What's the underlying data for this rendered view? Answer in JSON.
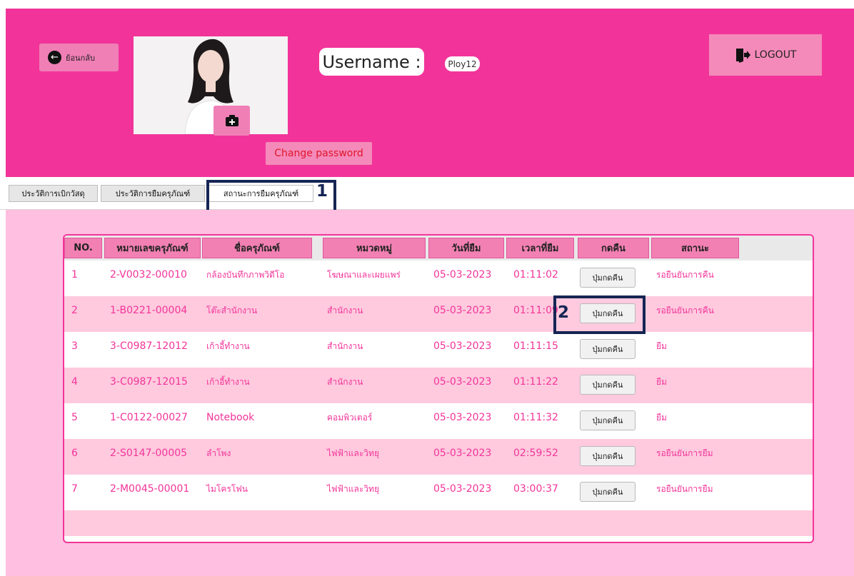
{
  "header": {
    "back_label": "ย้อนกลับ",
    "username_label": "Username :",
    "username_value": "Ploy12",
    "logout_label": "LOGOUT",
    "change_password_label": "Change password",
    "colors": {
      "header_bg": "#f2349a",
      "button_bg": "#f48ab9",
      "change_password_text": "#e0162c"
    }
  },
  "tabs": [
    {
      "label": "ประวัติการเบิกวัสดุ"
    },
    {
      "label": "ประวัติการยืมครุภัณฑ์"
    },
    {
      "label": "สถานะการยืมครุภัณฑ์",
      "selected": true
    }
  ],
  "annotations": [
    {
      "label": "1"
    },
    {
      "label": "2"
    }
  ],
  "table": {
    "columns": [
      "NO.",
      "หมายเลขครุภัณฑ์",
      "ชื่อครุภัณฑ์",
      "หมวดหมู่",
      "วันที่ยืม",
      "เวลาที่ยืม",
      "กดคืน",
      "สถานะ"
    ],
    "return_button_label": "ปุ่มกดคืน",
    "rows": [
      {
        "no": "1",
        "asset_id": "2-V0032-00010",
        "name": "กล้องบันทึกภาพวิดีโอ",
        "category": "โฆษณาและเผยแพร่",
        "date": "05-03-2023",
        "time": "01:11:02",
        "status": "รอยืนยันการคืน"
      },
      {
        "no": "2",
        "asset_id": "1-B0221-00004",
        "name": "โต๊ะสำนักงาน",
        "category": "สำนักงาน",
        "date": "05-03-2023",
        "time": "01:11:09",
        "status": "รอยืนยันการคืน"
      },
      {
        "no": "3",
        "asset_id": "3-C0987-12012",
        "name": "เก้าอี้ทำงาน",
        "category": "สำนักงาน",
        "date": "05-03-2023",
        "time": "01:11:15",
        "status": "ยืม"
      },
      {
        "no": "4",
        "asset_id": "3-C0987-12015",
        "name": "เก้าอี้ทำงาน",
        "category": "สำนักงาน",
        "date": "05-03-2023",
        "time": "01:11:22",
        "status": "ยืม"
      },
      {
        "no": "5",
        "asset_id": "1-C0122-00027",
        "name": "Notebook",
        "category": "คอมพิวเตอร์",
        "date": "05-03-2023",
        "time": "01:11:32",
        "status": "ยืม"
      },
      {
        "no": "6",
        "asset_id": "2-S0147-00005",
        "name": "ลำโพง",
        "category": "ไฟฟ้าและวิทยุ",
        "date": "05-03-2023",
        "time": "02:59:52",
        "status": "รอยืนยันการยืม"
      },
      {
        "no": "7",
        "asset_id": "2-M0045-00001",
        "name": "ไมโครโฟน",
        "category": "ไฟฟ้าและวิทยุ",
        "date": "05-03-2023",
        "time": "03:00:37",
        "status": "รอยืนยันการยืม"
      }
    ]
  }
}
